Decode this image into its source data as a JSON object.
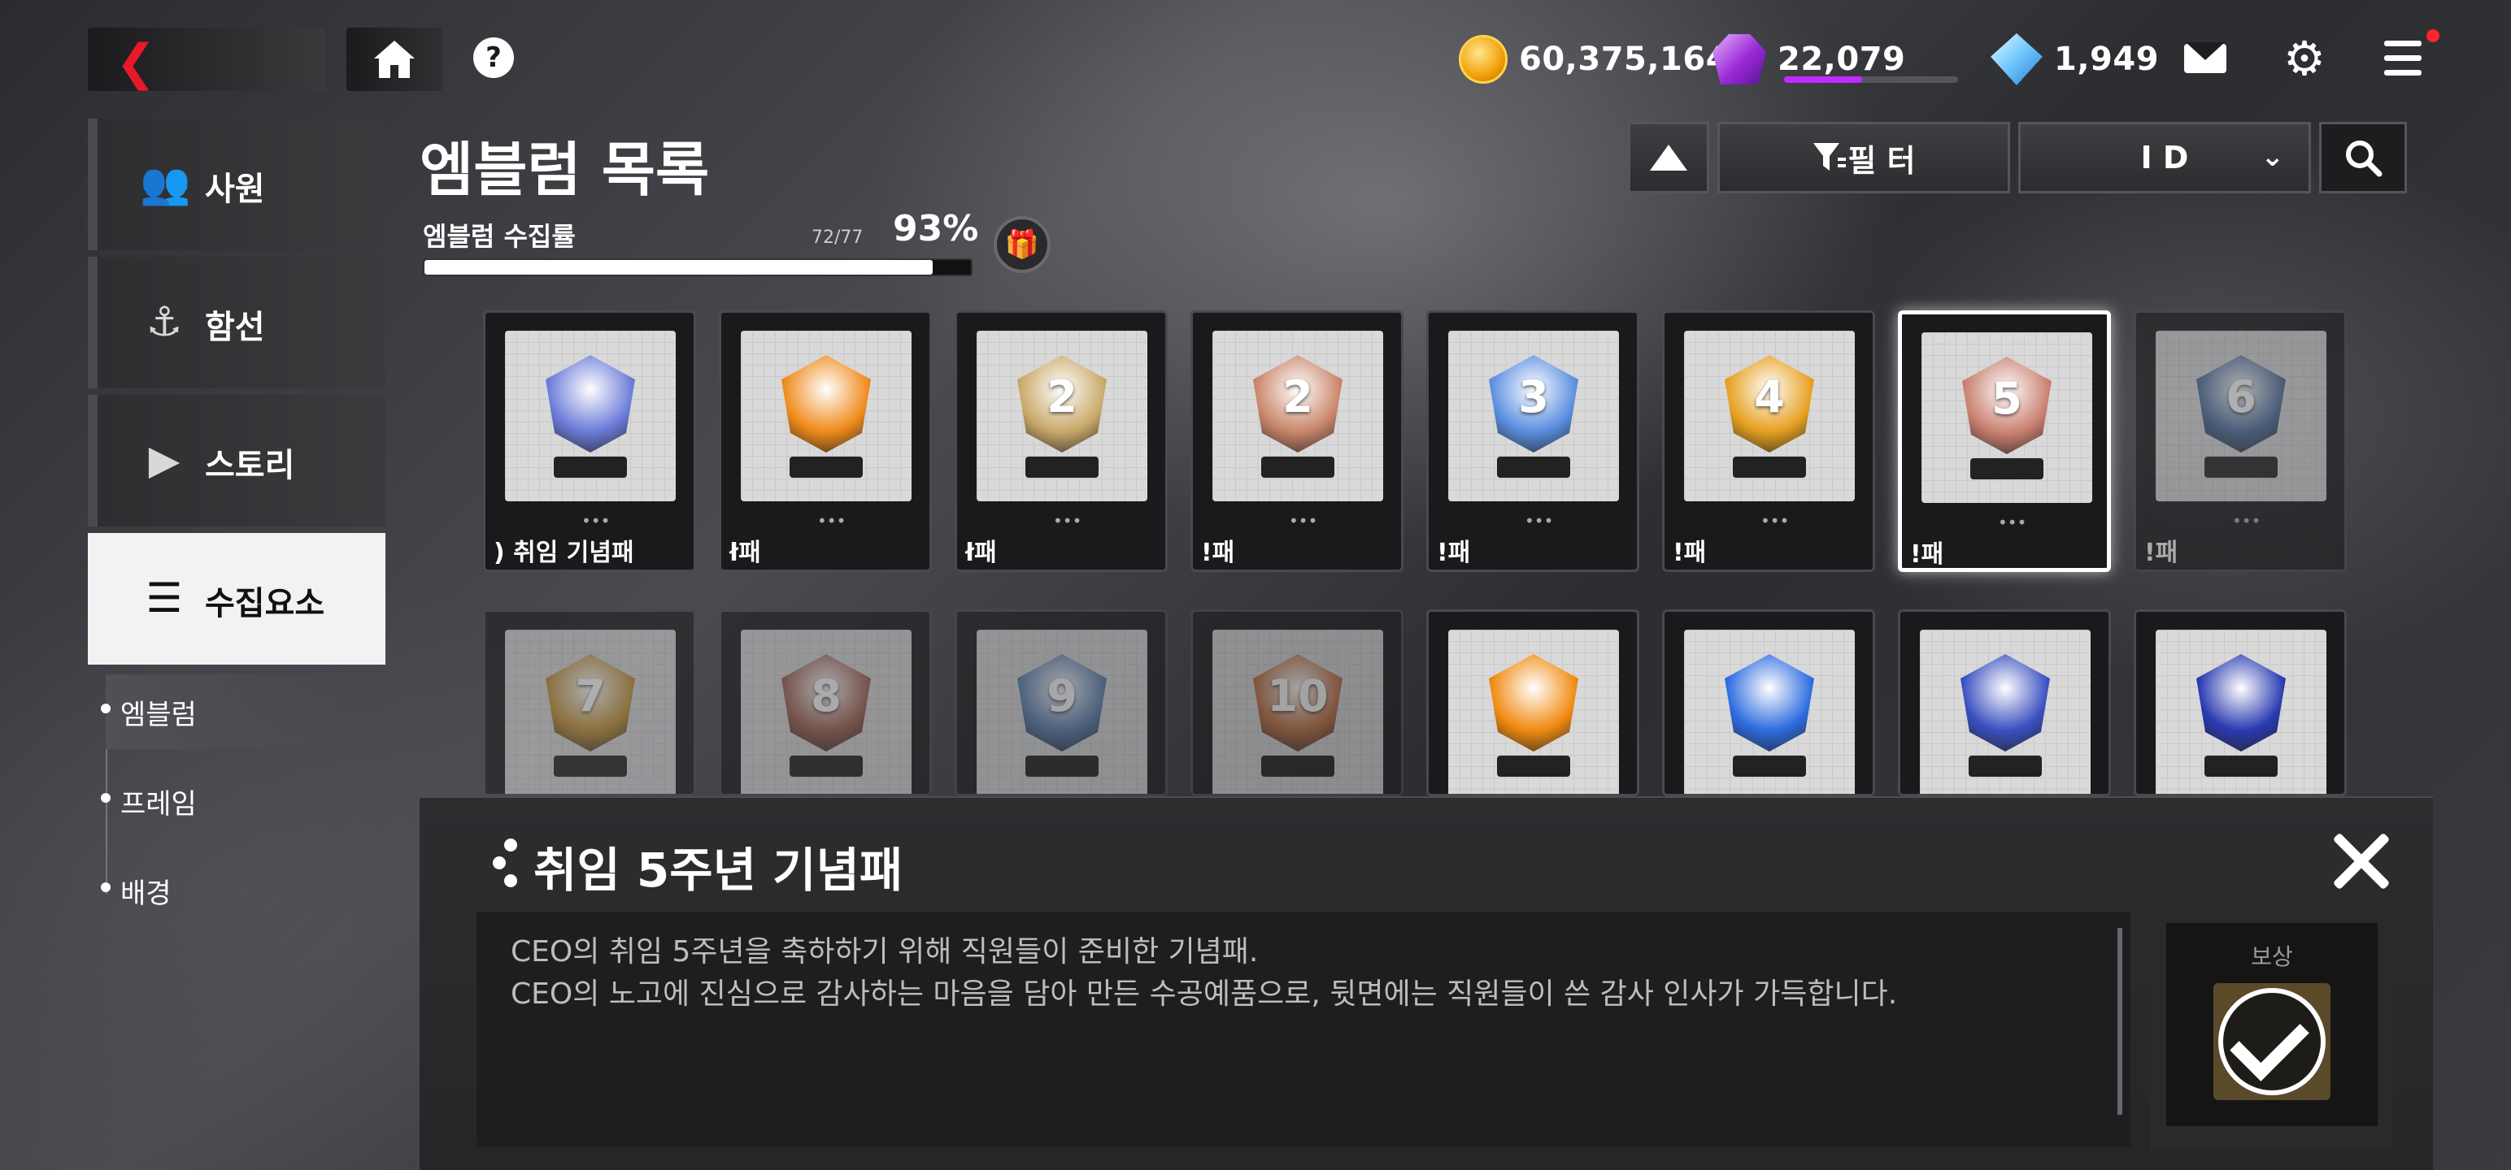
{
  "topbar": {
    "currencies": [
      {
        "icon": "gold-coin-icon",
        "value": "60,375,164"
      },
      {
        "icon": "purple-gem-icon",
        "value": "22,079",
        "bar_fraction": 0.45
      },
      {
        "icon": "blue-diamond-icon",
        "value": "1,949"
      }
    ],
    "help_glyph": "?"
  },
  "sidebar": {
    "items": [
      {
        "label": "사원",
        "icon": "employees-icon"
      },
      {
        "label": "함선",
        "icon": "ship-icon"
      },
      {
        "label": "스토리",
        "icon": "story-icon"
      },
      {
        "label": "수집요소",
        "icon": "collectibles-icon",
        "active": true
      }
    ],
    "sub_items": [
      {
        "label": "엠블럼",
        "active": true
      },
      {
        "label": "프레임"
      },
      {
        "label": "배경"
      }
    ]
  },
  "header": {
    "title": "엠블럼 목록",
    "collect_label": "엠블럼 수집률",
    "collect_count": "72/77",
    "collect_percent": "93%",
    "progress_fraction": 0.93
  },
  "controls": {
    "filter_label": "필 터",
    "sort_select": "I D"
  },
  "grid": {
    "row1": [
      {
        "name": ") 취임 기념패",
        "color": "#6b7bd8",
        "num": ""
      },
      {
        "name": "ł패",
        "color": "#f08a1a",
        "num": ""
      },
      {
        "name": "ł패",
        "color": "#c9a96a",
        "num": "2"
      },
      {
        "name": "!패",
        "color": "#c9866a",
        "num": "2"
      },
      {
        "name": "!패",
        "color": "#5a8ee0",
        "num": "3"
      },
      {
        "name": "!패",
        "color": "#e6a020",
        "num": "4"
      },
      {
        "name": "!패",
        "color": "#c98070",
        "num": "5",
        "selected": true
      },
      {
        "name": "!패",
        "color": "#4a6a9a",
        "num": "6",
        "locked": true
      }
    ],
    "row2": [
      {
        "name": "",
        "color": "#c09030",
        "num": "7",
        "locked": true
      },
      {
        "name": "",
        "color": "#a06050",
        "num": "8",
        "locked": true
      },
      {
        "name": "",
        "color": "#5a80b0",
        "num": "9",
        "locked": true
      },
      {
        "name": "",
        "color": "#c07040",
        "num": "10",
        "locked": true
      },
      {
        "name": "",
        "color": "#f08a10",
        "num": ""
      },
      {
        "name": "",
        "color": "#2d6ce0",
        "num": ""
      },
      {
        "name": "",
        "color": "#3a50c0",
        "num": ""
      },
      {
        "name": "",
        "color": "#2a3ab0",
        "num": ""
      }
    ]
  },
  "detail": {
    "title": "취임 5주년 기념패",
    "desc_line1": "CEO의 취임 5주년을 축하하기 위해 직원들이 준비한 기념패.",
    "desc_line2": "CEO의 노고에 진심으로 감사하는 마음을 담아 만든 수공예품으로, 뒷면에는 직원들이 쓴 감사 인사가 가득합니다.",
    "reward_label": "보상",
    "reward_claimed": true
  }
}
